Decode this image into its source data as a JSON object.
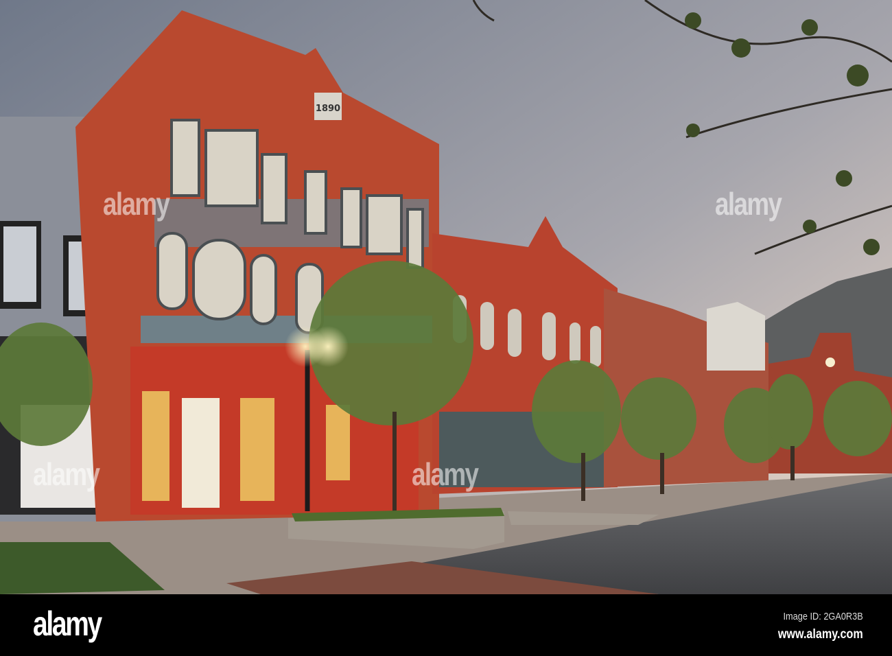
{
  "photo": {
    "building_date": "1890",
    "colors": {
      "sky_top": "#737c8e",
      "sky_glow": "#eadbcf",
      "brick": "#b9492f",
      "trim": "#6f8088",
      "road": "#545658"
    }
  },
  "watermark": {
    "text": "alamy"
  },
  "footer": {
    "logo": "alamy",
    "image_id": "Image ID: 2GA0R3B",
    "url": "www.alamy.com"
  }
}
